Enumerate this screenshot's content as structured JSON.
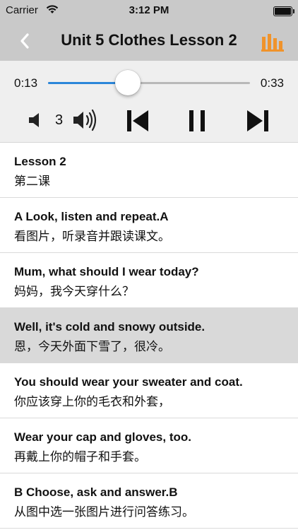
{
  "status_bar": {
    "carrier": "Carrier",
    "time": "3:12 PM",
    "icons": [
      "wifi-icon",
      "battery-icon"
    ]
  },
  "nav": {
    "title": "Unit 5 Clothes Lesson 2",
    "back_icon": "chevron-left-icon",
    "right_icon": "equalizer-bars-icon",
    "accent_color": "#f0932b"
  },
  "player": {
    "current_time": "0:13",
    "total_time": "0:33",
    "progress_percent": 39.4,
    "volume": "3",
    "icons": [
      "volume-down-icon",
      "volume-up-icon",
      "skip-previous-icon",
      "pause-icon",
      "skip-next-icon"
    ],
    "progress_color": "#2b86d9"
  },
  "lessons": [
    {
      "en": "Lesson 2",
      "zh": "第二课",
      "active": false
    },
    {
      "en": "A Look, listen and repeat.A",
      "zh": "看图片，听录音并跟读课文。",
      "active": false
    },
    {
      "en": "Mum, what should I wear today?",
      "zh": "妈妈，我今天穿什么？",
      "active": false
    },
    {
      "en": "Well, it's cold and snowy outside.",
      "zh": "恩，今天外面下雪了，很冷。",
      "active": true
    },
    {
      "en": "You should wear your sweater and coat.",
      "zh": "你应该穿上你的毛衣和外套，",
      "active": false
    },
    {
      "en": "Wear your cap and gloves, too.",
      "zh": "再戴上你的帽子和手套。",
      "active": false
    },
    {
      "en": "B Choose, ask and answer.B",
      "zh": "从图中选一张图片进行问答练习。",
      "active": false
    }
  ]
}
